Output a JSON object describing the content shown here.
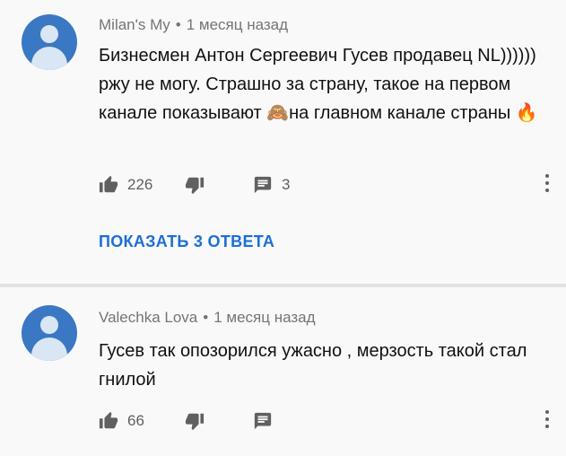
{
  "comments": [
    {
      "author": "Milan's My",
      "separator": "•",
      "time": "1 месяц назад",
      "text_1": "Бизнесмен Антон Сергеевич Гусев продавец NL)))))) ржу не могу. Страшно за страну, такое на первом канале показывают ",
      "emoji_1": "🙈",
      "text_2": "на главном канале страны ",
      "emoji_2": "🔥",
      "likes": "226",
      "replies": "3",
      "show_replies": "ПОКАЗАТЬ 3 ОТВЕТА"
    },
    {
      "author": "Valechka Lova",
      "separator": "•",
      "time": "1 месяц назад",
      "text": "Гусев так опозорился ужасно , мерзость такой стал гнилой",
      "likes": "66"
    }
  ],
  "icons": {
    "like": "thumb-up-icon",
    "dislike": "thumb-down-icon",
    "reply": "reply-icon",
    "more": "more-vertical-icon",
    "avatar": "default-avatar-icon"
  },
  "colors": {
    "avatar_bg": "#3a78c3",
    "link": "#1a6fd6",
    "meta": "#757575"
  }
}
